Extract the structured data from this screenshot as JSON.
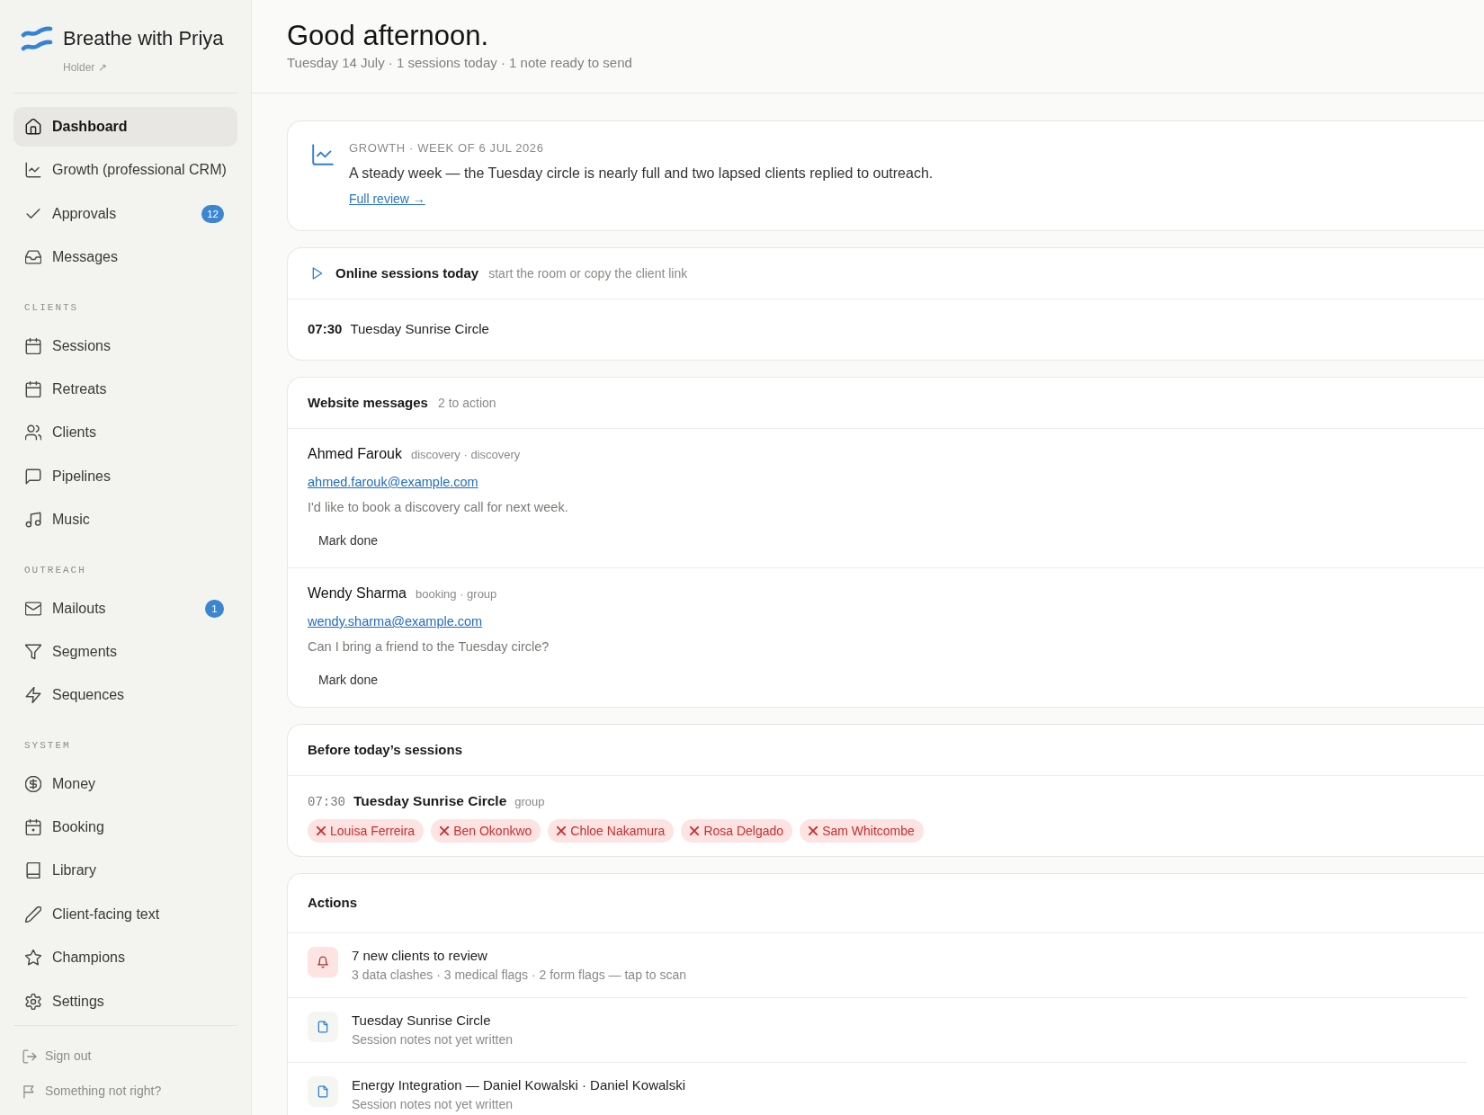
{
  "sidebar": {
    "brand": {
      "name": "Breathe with Priya",
      "link": "Holder ↗"
    },
    "sections": [
      {
        "items": [
          {
            "label": "Dashboard",
            "selected": true
          },
          {
            "label": "Growth (professional CRM)",
            "selected": false
          },
          {
            "label": "Approvals",
            "selected": false,
            "badge": "12"
          },
          {
            "label": "Messages",
            "selected": false
          }
        ]
      },
      {
        "heading": "CLIENTS",
        "items": [
          {
            "label": "Sessions",
            "selected": false
          },
          {
            "label": "Retreats",
            "selected": false
          },
          {
            "label": "Clients",
            "selected": false
          },
          {
            "label": "Pipelines",
            "selected": false
          },
          {
            "label": "Music",
            "selected": false
          }
        ]
      },
      {
        "heading": "OUTREACH",
        "items": [
          {
            "label": "Mailouts",
            "selected": false,
            "badge": "1"
          },
          {
            "label": "Segments",
            "selected": false
          },
          {
            "label": "Sequences",
            "selected": false
          }
        ]
      },
      {
        "heading": "SYSTEM",
        "items": [
          {
            "label": "Money",
            "selected": false
          },
          {
            "label": "Booking",
            "selected": false
          },
          {
            "label": "Library",
            "selected": false
          },
          {
            "label": "Client-facing text",
            "selected": false
          },
          {
            "label": "Champions",
            "selected": false
          },
          {
            "label": "Settings",
            "selected": false
          }
        ]
      }
    ],
    "footer_links": [
      "Sign out",
      "Something not right?"
    ]
  },
  "header": {
    "title": "Good afternoon.",
    "subtitle": "Tuesday 14 July · 1 sessions today · 1 note ready to send"
  },
  "growth_summary": {
    "kicker": "GROWTH · WEEK OF 6 JUL 2026",
    "text": "A steady week — the Tuesday circle is nearly full and two lapsed clients replied to outreach.",
    "link": "Full review →"
  },
  "online_sessions": {
    "title": "Online sessions today",
    "hint": "start the room or copy the client link",
    "sessions": [
      {
        "time": "07:30",
        "name": "Tuesday Sunrise Circle"
      }
    ]
  },
  "website_messages": {
    "title": "Website messages",
    "count": "2 to action",
    "messages": [
      {
        "name": "Ahmed Farouk",
        "tags": "discovery · discovery",
        "email": "ahmed.farouk@example.com",
        "text": "I'd like to book a discovery call for next week.",
        "button": "Mark done"
      },
      {
        "name": "Wendy Sharma",
        "tags": "booking · group",
        "email": "wendy.sharma@example.com",
        "text": "Can I bring a friend to the Tuesday circle?",
        "button": "Mark done"
      }
    ]
  },
  "before_sessions": {
    "title": "Before today’s sessions",
    "sessions": [
      {
        "time": "07:30",
        "name": "Tuesday Sunrise Circle",
        "type": "group",
        "clients": [
          "Louisa Ferreira",
          "Ben Okonkwo",
          "Chloe Nakamura",
          "Rosa Delgado",
          "Sam Whitcombe"
        ]
      }
    ]
  },
  "actions": {
    "title": "Actions",
    "items": [
      {
        "kind": "alert",
        "title": "7 new clients to review",
        "detail": "3 data clashes · 3 medical flags · 2 form flags — tap to scan"
      },
      {
        "kind": "note",
        "title": "Tuesday Sunrise Circle",
        "detail": "Session notes not yet written"
      },
      {
        "kind": "note",
        "title": "Energy Integration — Daniel Kowalski · Daniel Kowalski",
        "detail": "Session notes not yet written"
      }
    ]
  }
}
